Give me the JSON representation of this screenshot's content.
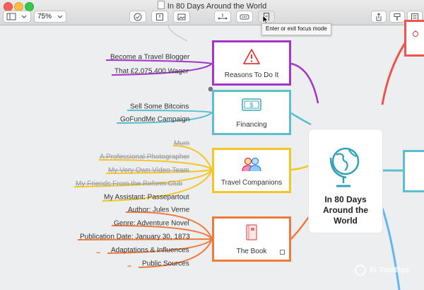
{
  "window": {
    "title": "In 80 Days Around the World"
  },
  "toolbar": {
    "zoom": "75%"
  },
  "tooltip": {
    "text": "Enter or exit focus mode"
  },
  "central": {
    "line1": "In 80 Days",
    "line2": "Around the",
    "line3": "World"
  },
  "topics": {
    "reasons": {
      "label": "Reasons To Do It",
      "color": "#a335c9",
      "items": [
        "Become a Travel Blogger",
        "That £2,075,400 Wager"
      ]
    },
    "financing": {
      "label": "Financing",
      "color": "#5bbfd0",
      "items": [
        "Sell Some Bitcoins",
        "GoFundMe Campaign"
      ]
    },
    "companions": {
      "label": "Travel Companions",
      "color": "#f5c623",
      "items": [
        "Mum",
        "A Professional Photographer",
        "My Very Own Video Team",
        "My Friends From the Reform Club",
        "My Assistant: Passepartout"
      ]
    },
    "book": {
      "label": "The Book",
      "color": "#f07a3c",
      "items": [
        "Author: Jules Verne",
        "Genre: Adventure Novel",
        "Publication Date: January 30, 1873",
        "Adaptations & Influences",
        "Public Sources"
      ],
      "more": "..."
    }
  },
  "colors": {
    "right_red": "#ef5350",
    "right_teal": "#5bbfd0",
    "right_blue": "#64b5f6"
  },
  "watermark": {
    "text": "AI ToolBox"
  }
}
